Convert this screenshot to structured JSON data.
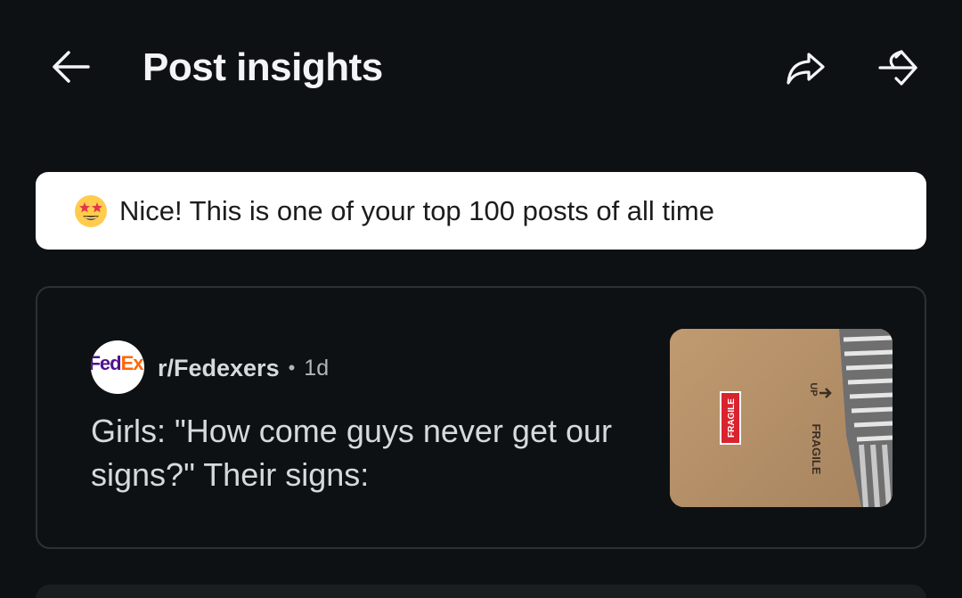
{
  "header": {
    "title": "Post insights",
    "back_icon": "arrow-left-icon",
    "share_icon": "share-icon",
    "crosspost_icon": "crosspost-icon"
  },
  "banner": {
    "emoji": "star-struck-emoji",
    "text": "Nice! This is one of your top 100 posts of all time"
  },
  "post": {
    "subreddit": "r/Fedexers",
    "separator": "•",
    "age": "1d",
    "title": "Girls: \"How come guys never get our signs?\" Their signs:",
    "avatar_logo": {
      "fed": "Fed",
      "ex": "Ex"
    },
    "thumbnail": {
      "description_icon": "box-photo-thumbnail",
      "label_text": "FRAGILE",
      "stencil_text": "FRAGILE",
      "arrow_text": "UP"
    }
  },
  "colors": {
    "background": "#0e1113",
    "banner_bg": "#ffffff",
    "card_border": "#2a3236",
    "text_primary": "#f2f4f5",
    "text_secondary": "#b0b6b9",
    "fedex_purple": "#4d148c",
    "fedex_orange": "#ff6600"
  }
}
